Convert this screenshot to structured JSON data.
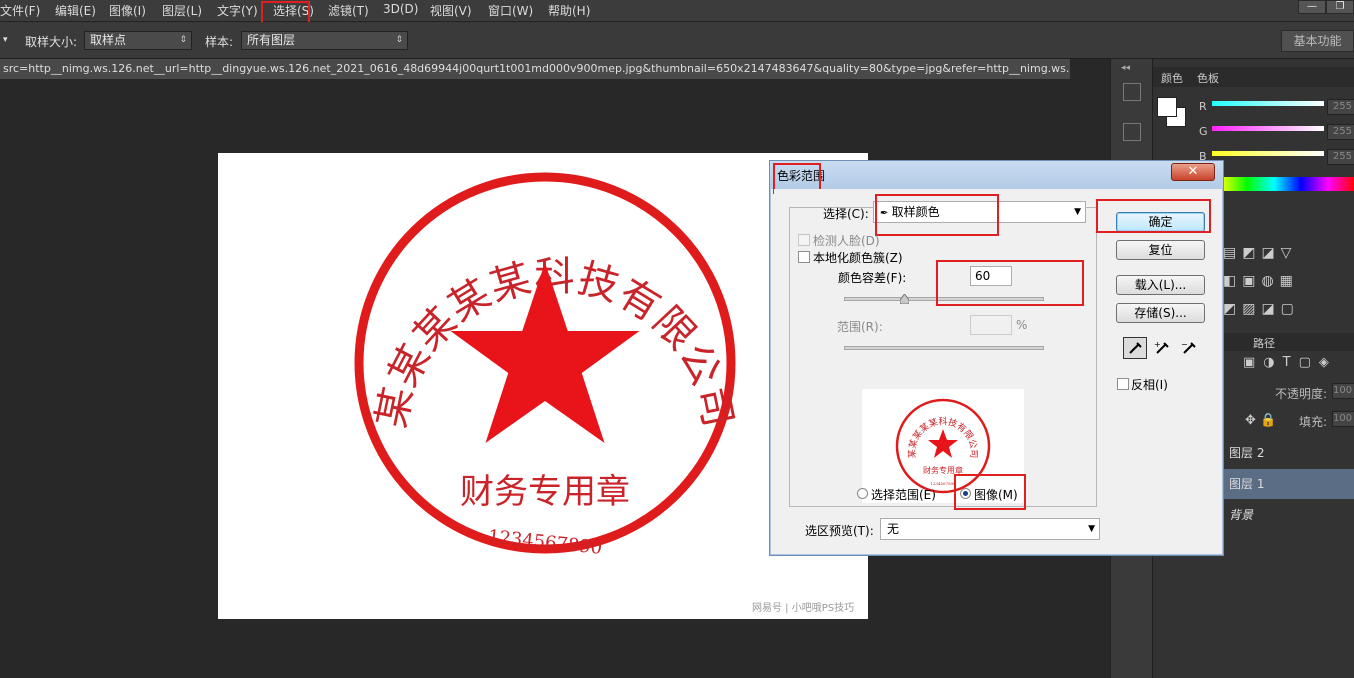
{
  "menubar": {
    "items": [
      "文件(F)",
      "编辑(E)",
      "图像(I)",
      "图层(L)",
      "文字(Y)",
      "选择(S)",
      "滤镜(T)",
      "3D(D)",
      "视图(V)",
      "窗口(W)",
      "帮助(H)"
    ],
    "window_minimize": "—",
    "window_restore": "❐"
  },
  "options_bar": {
    "sample_size_label": "取样大小:",
    "sample_size_value": "取样点",
    "sample_label": "样本:",
    "sample_value": "所有图层",
    "workspace": "基本功能"
  },
  "document": {
    "tab_title": "src=http__nimg.ws.126.net__url=http__dingyue.ws.126.net_2021_0616_48d69944j00qurt1t001md000v900mep.jpg&thumbnail=650x2147483647&quality=80&type=jpg&refer=http__nimg.ws.126"
  },
  "canvas_image": {
    "stamp_ring_text": "某某某某某科技有限公司",
    "stamp_label": "财务专用章",
    "stamp_number": "1234567890",
    "watermark": "网易号 | 小吧哦PS技巧",
    "stamp_color": "#e01b1b"
  },
  "right_panel": {
    "tabs": [
      "颜色",
      "色板"
    ],
    "channels": [
      {
        "name": "R",
        "value": "255"
      },
      {
        "name": "G",
        "value": "255"
      },
      {
        "name": "B",
        "value": "255"
      }
    ],
    "paths_tab": "路径",
    "opacity_label": "不透明度:",
    "opacity_value": "100",
    "fill_label": "填充:",
    "fill_value": "100",
    "layers": [
      "图层 2",
      "图层 1",
      "背景"
    ]
  },
  "dialog": {
    "title": "色彩范围",
    "close": "✕",
    "select_label": "选择(C):",
    "select_value": "取样颜色",
    "detect_faces": "检测人脸(D)",
    "localized_clusters": "本地化颜色簇(Z)",
    "fuzziness_label": "颜色容差(F):",
    "fuzziness_value": "60",
    "range_label": "范围(R):",
    "range_unit": "%",
    "radio_selection": "选择范围(E)",
    "radio_image": "图像(M)",
    "selection_preview_label": "选区预览(T):",
    "selection_preview_value": "无",
    "ok": "确定",
    "reset": "复位",
    "load": "载入(L)...",
    "save": "存储(S)...",
    "invert": "反相(I)"
  }
}
